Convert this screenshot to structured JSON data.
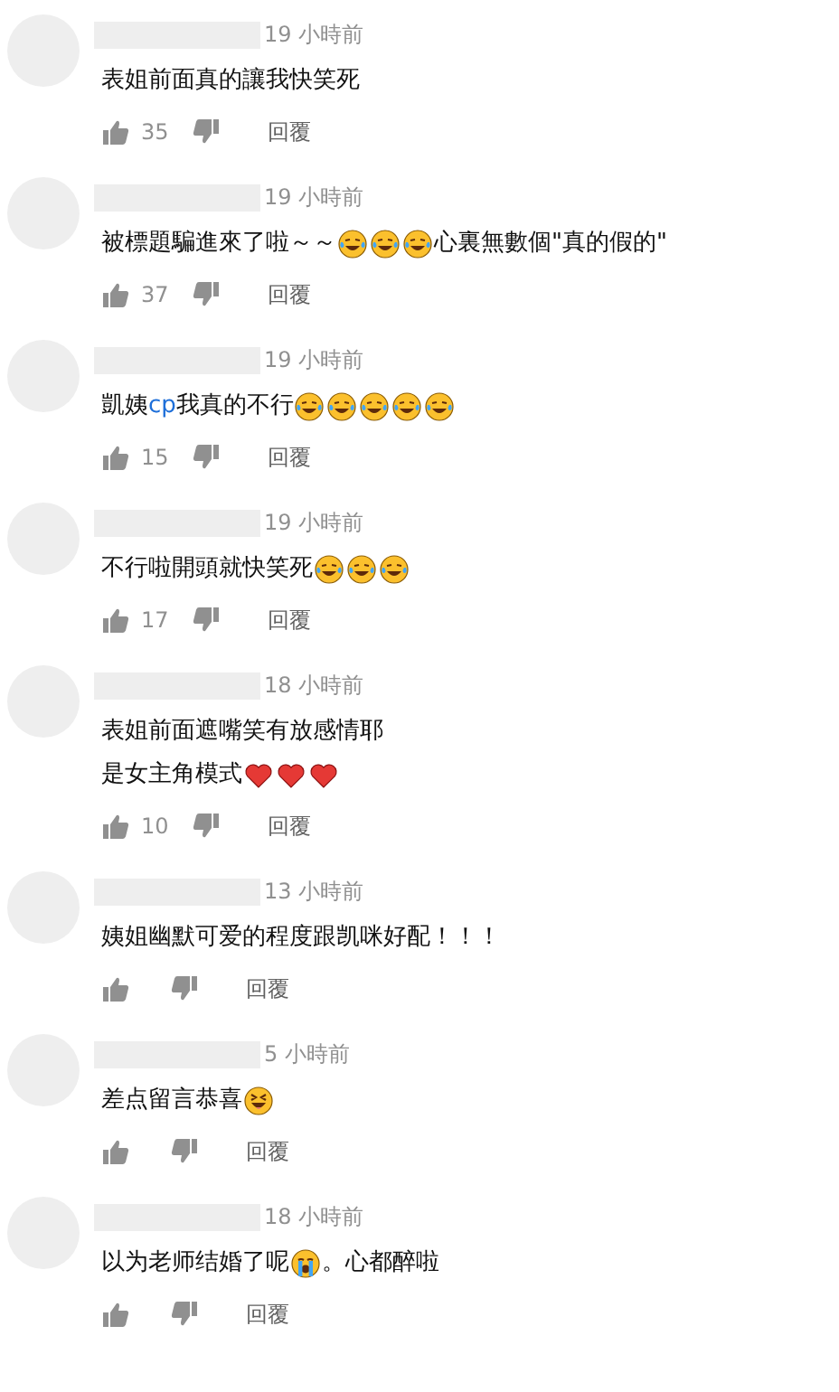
{
  "comments": [
    {
      "time": "19 小時前",
      "body": [
        [
          {
            "kind": "text",
            "text": "表姐前面真的讓我快笑死"
          }
        ]
      ],
      "likes": "35",
      "reply": "回覆"
    },
    {
      "time": "19 小時前",
      "body": [
        [
          {
            "kind": "text",
            "text": "被標題騙進來了啦～～"
          },
          {
            "kind": "laugh-cry"
          },
          {
            "kind": "laugh-cry"
          },
          {
            "kind": "laugh-cry"
          },
          {
            "kind": "text",
            "text": "心裏無數個\"真的假的\""
          }
        ]
      ],
      "likes": "37",
      "reply": "回覆"
    },
    {
      "time": "19 小時前",
      "body": [
        [
          {
            "kind": "text",
            "text": "凱姨"
          },
          {
            "kind": "link",
            "text": "cp"
          },
          {
            "kind": "text",
            "text": "我真的不行"
          },
          {
            "kind": "laugh-cry"
          },
          {
            "kind": "laugh-cry"
          },
          {
            "kind": "laugh-cry"
          },
          {
            "kind": "laugh-cry"
          },
          {
            "kind": "laugh-cry"
          }
        ]
      ],
      "likes": "15",
      "reply": "回覆"
    },
    {
      "time": "19 小時前",
      "body": [
        [
          {
            "kind": "text",
            "text": "不行啦開頭就快笑死"
          },
          {
            "kind": "laugh-cry"
          },
          {
            "kind": "laugh-cry"
          },
          {
            "kind": "laugh-cry"
          }
        ]
      ],
      "likes": "17",
      "reply": "回覆"
    },
    {
      "time": "18 小時前",
      "body": [
        [
          {
            "kind": "text",
            "text": "表姐前面遮嘴笑有放感情耶"
          }
        ],
        [
          {
            "kind": "text",
            "text": "是女主角模式"
          },
          {
            "kind": "heart"
          },
          {
            "kind": "heart"
          },
          {
            "kind": "heart"
          }
        ]
      ],
      "likes": "10",
      "reply": "回覆"
    },
    {
      "time": "13 小時前",
      "body": [
        [
          {
            "kind": "text",
            "text": "姨姐幽默可爱的程度跟凯咪好配！！！"
          }
        ]
      ],
      "reply": "回覆"
    },
    {
      "time": "5 小時前",
      "body": [
        [
          {
            "kind": "text",
            "text": "差点留言恭喜"
          },
          {
            "kind": "squint-laugh"
          }
        ]
      ],
      "reply": "回覆"
    },
    {
      "time": "18 小時前",
      "body": [
        [
          {
            "kind": "text",
            "text": "以为老师结婚了呢"
          },
          {
            "kind": "sob"
          },
          {
            "kind": "text",
            "text": "。心都醉啦"
          }
        ]
      ],
      "reply": "回覆"
    }
  ]
}
